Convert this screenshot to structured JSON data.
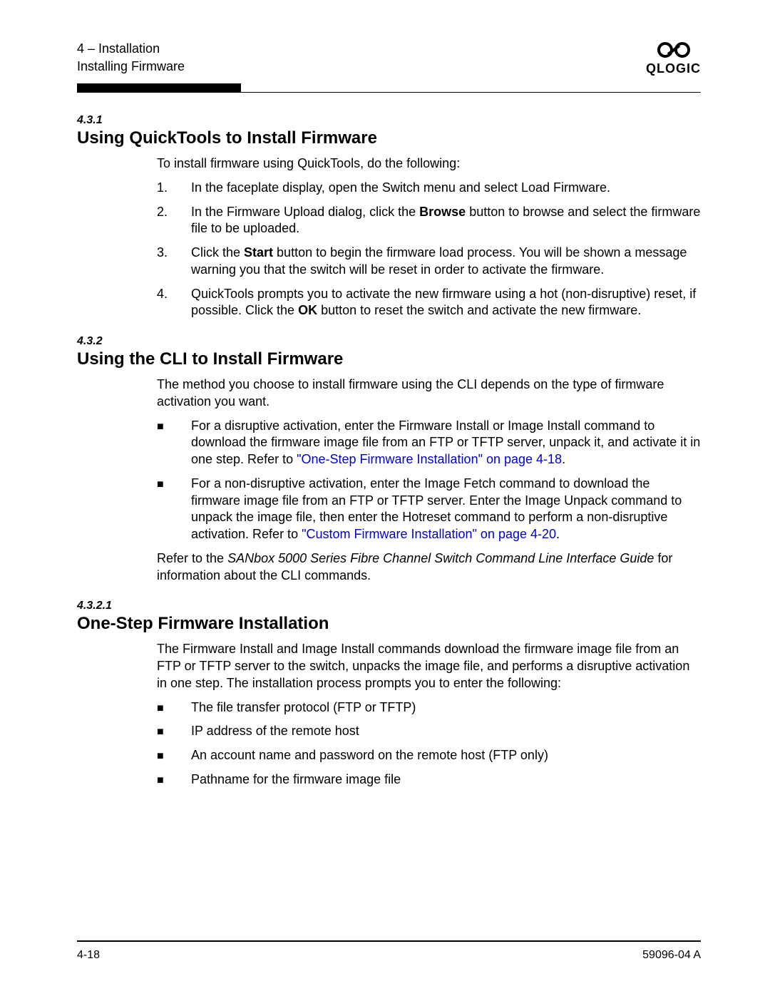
{
  "header": {
    "chapter": "4 – Installation",
    "section": "Installing Firmware",
    "brand": "QLOGIC"
  },
  "s431": {
    "num": "4.3.1",
    "title": "Using QuickTools to Install Firmware",
    "intro": "To install firmware using QuickTools, do the following:",
    "steps": [
      {
        "n": "1.",
        "pre": "In the faceplate display, open the Switch menu and select Load Firmware."
      },
      {
        "n": "2.",
        "pre": "In the Firmware Upload dialog, click the ",
        "b1": "Browse",
        "post": " button to browse and select the firmware file to be uploaded."
      },
      {
        "n": "3.",
        "pre": "Click the ",
        "b1": "Start",
        "post": " button to begin the firmware load process. You will be shown a message warning you that the switch will be reset in order to activate the firmware."
      },
      {
        "n": "4.",
        "pre": "QuickTools prompts you to activate the new firmware using a hot (non-disruptive) reset, if possible. Click the ",
        "b1": "OK",
        "post": " button to reset the switch and activate the new firmware."
      }
    ]
  },
  "s432": {
    "num": "4.3.2",
    "title": "Using the CLI to Install Firmware",
    "intro": "The method you choose to install firmware using the CLI depends on the type of firmware activation you want.",
    "bullets": [
      {
        "pre": "For a disruptive activation, enter the Firmware Install or Image Install command to download the firmware image file from an FTP or TFTP server, unpack it, and activate it in one step. Refer to ",
        "link": "\"One-Step Firmware Installation\" on page 4-18",
        "post": "."
      },
      {
        "pre": "For a non-disruptive activation, enter the Image Fetch command to download the firmware image file from an FTP or TFTP server. Enter the Image Unpack command to unpack the image file, then enter the Hotreset command to perform a non-disruptive activation. Refer to ",
        "link": "\"Custom Firmware Installation\" on page 4-20",
        "post": "."
      }
    ],
    "ref_pre": "Refer to the ",
    "ref_ital": "SANbox 5000 Series Fibre Channel Switch Command Line Interface Guide",
    "ref_post": " for information about the CLI commands."
  },
  "s4321": {
    "num": "4.3.2.1",
    "title": "One-Step Firmware Installation",
    "intro": "The Firmware Install and Image Install commands download the firmware image file from an FTP or TFTP server to the switch, unpacks the image file, and performs a disruptive activation in one step. The installation process prompts you to enter the following:",
    "bullets": [
      {
        "t": "The file transfer protocol (FTP or TFTP)"
      },
      {
        "t": "IP address of the remote host"
      },
      {
        "t": "An account name and password on the remote host (FTP only)"
      },
      {
        "t": "Pathname for the firmware image file"
      }
    ]
  },
  "footer": {
    "page": "4-18",
    "doc": "59096-04  A"
  }
}
